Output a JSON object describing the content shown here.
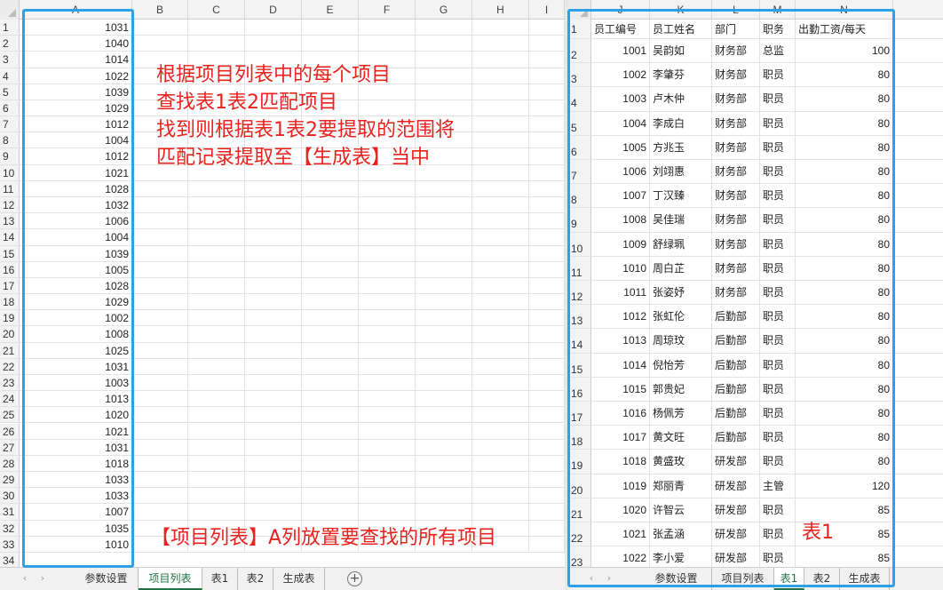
{
  "left_columns": [
    "A",
    "B",
    "C",
    "D",
    "E",
    "F",
    "G",
    "H",
    "I"
  ],
  "left_rows": [
    {
      "n": "1",
      "a": "1031"
    },
    {
      "n": "2",
      "a": "1040"
    },
    {
      "n": "3",
      "a": "1014"
    },
    {
      "n": "4",
      "a": "1022"
    },
    {
      "n": "5",
      "a": "1039"
    },
    {
      "n": "6",
      "a": "1029"
    },
    {
      "n": "7",
      "a": "1012"
    },
    {
      "n": "8",
      "a": "1004"
    },
    {
      "n": "9",
      "a": "1012"
    },
    {
      "n": "10",
      "a": "1021"
    },
    {
      "n": "11",
      "a": "1028"
    },
    {
      "n": "12",
      "a": "1032"
    },
    {
      "n": "13",
      "a": "1006"
    },
    {
      "n": "14",
      "a": "1004"
    },
    {
      "n": "15",
      "a": "1039"
    },
    {
      "n": "16",
      "a": "1005"
    },
    {
      "n": "17",
      "a": "1028"
    },
    {
      "n": "18",
      "a": "1029"
    },
    {
      "n": "19",
      "a": "1002"
    },
    {
      "n": "20",
      "a": "1008"
    },
    {
      "n": "21",
      "a": "1025"
    },
    {
      "n": "22",
      "a": "1031"
    },
    {
      "n": "23",
      "a": "1003"
    },
    {
      "n": "24",
      "a": "1013"
    },
    {
      "n": "25",
      "a": "1020"
    },
    {
      "n": "26",
      "a": "1021"
    },
    {
      "n": "27",
      "a": "1031"
    },
    {
      "n": "28",
      "a": "1018"
    },
    {
      "n": "29",
      "a": "1033"
    },
    {
      "n": "30",
      "a": "1033"
    },
    {
      "n": "31",
      "a": "1007"
    },
    {
      "n": "32",
      "a": "1035"
    },
    {
      "n": "33",
      "a": "1010"
    }
  ],
  "annotation_main": [
    "根据项目列表中的每个项目",
    "查找表1表2匹配项目",
    "找到则根据表1表2要提取的范围将",
    "匹配记录提取至【生成表】当中"
  ],
  "annotation_bottom": "【项目列表】A列放置要查找的所有项目",
  "annotation_table1": "表1",
  "right_columns": [
    "J",
    "K",
    "L",
    "M",
    "N"
  ],
  "right_header_row": {
    "n": "1",
    "j": "员工编号",
    "k": "员工姓名",
    "l": "部门",
    "m": "职务",
    "nv": "出勤工资/每天"
  },
  "right_rows": [
    {
      "n": "2",
      "j": "1001",
      "k": "吴韵如",
      "l": "财务部",
      "m": "总监",
      "nv": "100"
    },
    {
      "n": "3",
      "j": "1002",
      "k": "李肇芬",
      "l": "财务部",
      "m": "职员",
      "nv": "80"
    },
    {
      "n": "4",
      "j": "1003",
      "k": "卢木仲",
      "l": "财务部",
      "m": "职员",
      "nv": "80"
    },
    {
      "n": "5",
      "j": "1004",
      "k": "李成白",
      "l": "财务部",
      "m": "职员",
      "nv": "80"
    },
    {
      "n": "6",
      "j": "1005",
      "k": "方兆玉",
      "l": "财务部",
      "m": "职员",
      "nv": "80"
    },
    {
      "n": "7",
      "j": "1006",
      "k": "刘翊惠",
      "l": "财务部",
      "m": "职员",
      "nv": "80"
    },
    {
      "n": "8",
      "j": "1007",
      "k": "丁汉臻",
      "l": "财务部",
      "m": "职员",
      "nv": "80"
    },
    {
      "n": "9",
      "j": "1008",
      "k": "吴佳瑞",
      "l": "财务部",
      "m": "职员",
      "nv": "80"
    },
    {
      "n": "10",
      "j": "1009",
      "k": "舒绿珮",
      "l": "财务部",
      "m": "职员",
      "nv": "80"
    },
    {
      "n": "11",
      "j": "1010",
      "k": "周白芷",
      "l": "财务部",
      "m": "职员",
      "nv": "80"
    },
    {
      "n": "12",
      "j": "1011",
      "k": "张姿妤",
      "l": "财务部",
      "m": "职员",
      "nv": "80"
    },
    {
      "n": "13",
      "j": "1012",
      "k": "张虹伦",
      "l": "后勤部",
      "m": "职员",
      "nv": "80"
    },
    {
      "n": "14",
      "j": "1013",
      "k": "周琼玟",
      "l": "后勤部",
      "m": "职员",
      "nv": "80"
    },
    {
      "n": "15",
      "j": "1014",
      "k": "倪怡芳",
      "l": "后勤部",
      "m": "职员",
      "nv": "80"
    },
    {
      "n": "16",
      "j": "1015",
      "k": "郭贵妃",
      "l": "后勤部",
      "m": "职员",
      "nv": "80"
    },
    {
      "n": "17",
      "j": "1016",
      "k": "杨佩芳",
      "l": "后勤部",
      "m": "职员",
      "nv": "80"
    },
    {
      "n": "18",
      "j": "1017",
      "k": "黄文旺",
      "l": "后勤部",
      "m": "职员",
      "nv": "80"
    },
    {
      "n": "19",
      "j": "1018",
      "k": "黄盛玫",
      "l": "研发部",
      "m": "职员",
      "nv": "80"
    },
    {
      "n": "20",
      "j": "1019",
      "k": "郑丽青",
      "l": "研发部",
      "m": "主管",
      "nv": "120"
    },
    {
      "n": "21",
      "j": "1020",
      "k": "许智云",
      "l": "研发部",
      "m": "职员",
      "nv": "85"
    },
    {
      "n": "22",
      "j": "1021",
      "k": "张孟涵",
      "l": "研发部",
      "m": "职员",
      "nv": "85"
    },
    {
      "n": "23",
      "j": "1022",
      "k": "李小爱",
      "l": "研发部",
      "m": "职员",
      "nv": "85"
    }
  ],
  "left_tabs": [
    "参数设置",
    "项目列表",
    "表1",
    "表2",
    "生成表"
  ],
  "left_active_tab": "项目列表",
  "left_add_tab": "+",
  "right_tabs": [
    "参数设置",
    "项目列表",
    "表1",
    "表2",
    "生成表"
  ],
  "right_active_tab": "表1",
  "nav_prev": "‹",
  "nav_next": "›",
  "colors": {
    "highlight": "#2ea0e6",
    "annotation": "#e8231e",
    "active_tab": "#217346"
  }
}
